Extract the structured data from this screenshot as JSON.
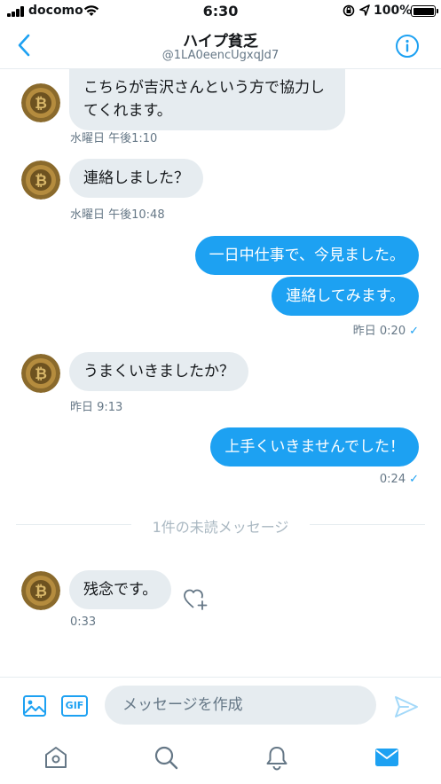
{
  "status_bar": {
    "carrier": "docomo",
    "time": "6:30",
    "battery": "100%"
  },
  "header": {
    "title": "ハイプ貧乏",
    "handle": "@1LA0eencUgxqJd7"
  },
  "messages": [
    {
      "direction": "in",
      "text": "こちらが吉沢さんという方で協力してくれます。",
      "meta": "水曜日 午後1:10"
    },
    {
      "direction": "in",
      "text": "連絡しました？",
      "meta": "水曜日 午後10:48"
    },
    {
      "direction": "out",
      "text": "一日中仕事で、今見ました。"
    },
    {
      "direction": "out",
      "text": "連絡してみます。",
      "meta": "昨日 0:20",
      "read": "✓"
    },
    {
      "direction": "in",
      "text": "うまくいきましたか？",
      "meta": "昨日 9:13"
    },
    {
      "direction": "out",
      "text": "上手くいきませんでした！",
      "meta": "0:24",
      "read": "✓"
    },
    {
      "direction": "in",
      "text": "残念です。",
      "meta": "0:33"
    }
  ],
  "unread_divider": "1件の未読メッセージ",
  "compose": {
    "placeholder": "メッセージを作成",
    "gif_label": "GIF"
  },
  "colors": {
    "accent": "#1da1f2",
    "incoming_bubble": "#e6ecf0",
    "secondary_text": "#657786",
    "divider_text": "#aab8c2"
  },
  "icons": {
    "back": "chevron-left-icon",
    "info": "info-icon",
    "image": "image-icon",
    "send": "send-icon",
    "like": "heart-plus-icon",
    "tabs": [
      "home-icon",
      "search-icon",
      "bell-icon",
      "mail-icon"
    ]
  },
  "tabs": {
    "active": "messages"
  }
}
